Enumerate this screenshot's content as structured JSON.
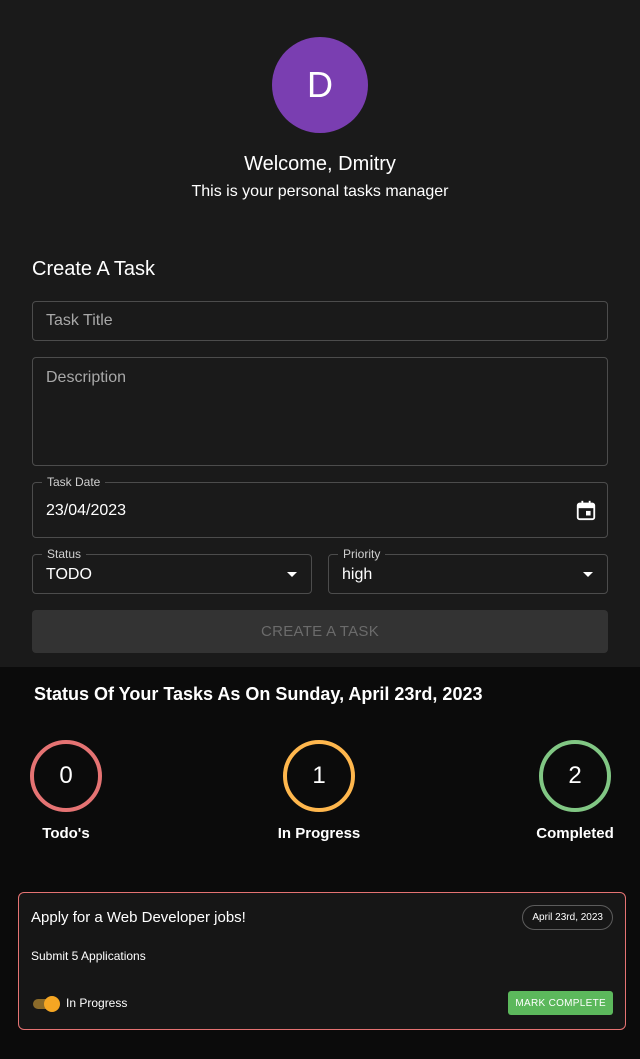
{
  "header": {
    "avatar_initial": "D",
    "welcome": "Welcome, Dmitry",
    "subtitle": "This is your personal tasks manager"
  },
  "form": {
    "heading": "Create A Task",
    "title_placeholder": "Task Title",
    "description_placeholder": "Description",
    "date_label": "Task Date",
    "date_value": "23/04/2023",
    "status_label": "Status",
    "status_value": "TODO",
    "priority_label": "Priority",
    "priority_value": "high",
    "submit_label": "CREATE A TASK"
  },
  "summary": {
    "heading": "Status Of Your Tasks As On Sunday, April 23rd, 2023",
    "stats": [
      {
        "count": "0",
        "label": "Todo's",
        "color": "#e57373"
      },
      {
        "count": "1",
        "label": "In Progress",
        "color": "#ffb74d"
      },
      {
        "count": "2",
        "label": "Completed",
        "color": "#81c784"
      }
    ]
  },
  "tasks": [
    {
      "title": "Apply for a Web Developer jobs!",
      "date": "April 23rd, 2023",
      "description": "Submit 5 Applications",
      "status": "In Progress",
      "toggle_on": true,
      "action_label": "MARK COMPLETE",
      "border_color": "#e57373"
    }
  ],
  "colors": {
    "avatar": "#7a3eb1",
    "top_bg": "#1a1a1a",
    "bottom_bg": "#0b0b0b",
    "mark_button": "#5cb85c",
    "toggle": "#f5a623"
  }
}
